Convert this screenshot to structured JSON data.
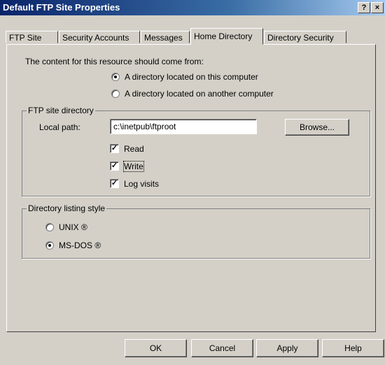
{
  "window": {
    "title": "Default FTP Site Properties",
    "help_button": "?",
    "close_button": "×"
  },
  "tabs": [
    {
      "label": "FTP Site",
      "active": false
    },
    {
      "label": "Security Accounts",
      "active": false
    },
    {
      "label": "Messages",
      "active": false
    },
    {
      "label": "Home Directory",
      "active": true
    },
    {
      "label": "Directory Security",
      "active": false
    }
  ],
  "home": {
    "content_source_label": "The content for this resource should come from:",
    "radio_local": {
      "label": "A directory located on this computer",
      "selected": true
    },
    "radio_remote": {
      "label": "A directory located on another computer",
      "selected": false
    }
  },
  "ftp_dir": {
    "legend": "FTP site directory",
    "local_path_label": "Local path:",
    "local_path_value": "c:\\inetpub\\ftproot",
    "browse_label": "Browse...",
    "read": {
      "label": "Read",
      "checked": true
    },
    "write": {
      "label": "Write",
      "checked": true
    },
    "log_visits": {
      "label": "Log visits",
      "checked": true
    }
  },
  "listing": {
    "legend": "Directory listing style",
    "unix": {
      "label": "UNIX ®",
      "selected": false
    },
    "msdos": {
      "label": "MS-DOS ®",
      "selected": true
    }
  },
  "buttons": {
    "ok": "OK",
    "cancel": "Cancel",
    "apply": "Apply",
    "help": "Help"
  }
}
